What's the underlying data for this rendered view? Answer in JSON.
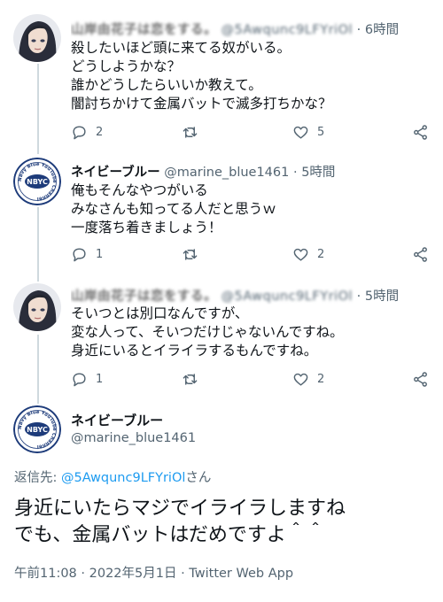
{
  "tweets": [
    {
      "display_name": "山岸由花子は恋をする。",
      "handle": "@5Awqunc9LFYriOl",
      "sep": "·",
      "time": "6時間",
      "text": "殺したいほど頭に来てる奴がいる。\nどうしようかな？\n誰かどうしたらいいか教えて。\n闇討ちかけて金属バットで滅多打ちかな？",
      "reply_count": "2",
      "retweet_count": "",
      "like_count": "5"
    },
    {
      "display_name": "ネイビーブルー",
      "handle": "@marine_blue1461",
      "sep": "·",
      "time": "5時間",
      "text": "俺もそんなやつがいる\nみなさんも知ってる人だと思うｗ\n一度落ち着きましょう！",
      "reply_count": "1",
      "retweet_count": "",
      "like_count": "2"
    },
    {
      "display_name": "山岸由花子は恋をする。",
      "handle": "@5Awqunc9LFYriOl",
      "sep": "·",
      "time": "5時間",
      "text": "そいつとは別口なんですが、\n変な人って、そいつだけじゃないんですね。\n身近にいるとイライラするもんですね。",
      "reply_count": "1",
      "retweet_count": "",
      "like_count": "2"
    }
  ],
  "main": {
    "display_name": "ネイビーブルー",
    "handle": "@marine_blue1461",
    "reply_label": "返信先: ",
    "reply_target": "@5Awqunc9LFYriOl",
    "reply_suffix": "さん",
    "text": "身近にいたらマジでイライラしますね\nでも、金属バットはだめですよ＾＾",
    "meta": "午前11:08 · 2022年5月1日 · Twitter Web App"
  },
  "logo": {
    "center_text": "NBYC",
    "ring_text": "Navy Blue YouTube Channel"
  },
  "icons": [
    "reply-icon",
    "retweet-icon",
    "like-icon",
    "share-icon"
  ],
  "colors": {
    "text": "#0f1419",
    "secondary": "#536471",
    "link": "#1d9bf0",
    "thread_line": "#cfd9de",
    "logo_navy": "#1d3b7a"
  }
}
